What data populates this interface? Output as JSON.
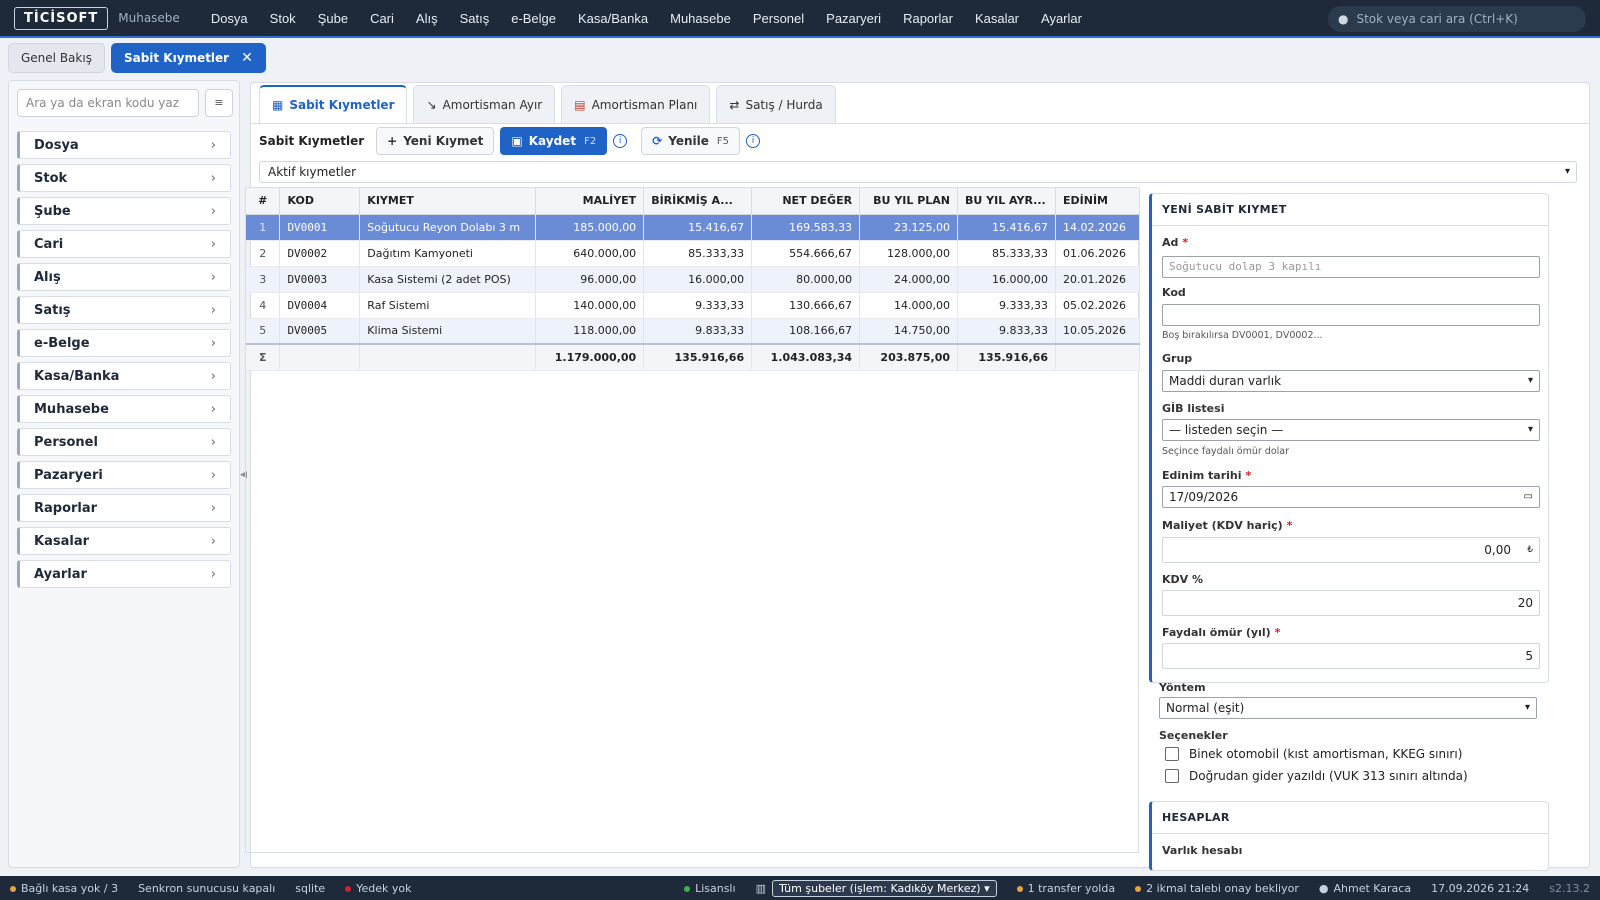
{
  "app": {
    "logo": "TİCİSOFT",
    "module": "Muhasebe"
  },
  "menu": [
    "Dosya",
    "Stok",
    "Şube",
    "Cari",
    "Alış",
    "Satış",
    "e-Belge",
    "Kasa/Banka",
    "Muhasebe",
    "Personel",
    "Pazaryeri",
    "Raporlar",
    "Kasalar",
    "Ayarlar"
  ],
  "global_search": {
    "placeholder": "Stok veya cari ara (Ctrl+K)"
  },
  "page_tabs": [
    {
      "label": "Genel Bakış"
    },
    {
      "label": "Sabit Kıymetler"
    }
  ],
  "page_tab_close": "✕",
  "sidebar": {
    "search_placeholder": "Ara ya da ekran kodu yaz",
    "items": [
      "Dosya",
      "Stok",
      "Şube",
      "Cari",
      "Alış",
      "Satış",
      "e-Belge",
      "Kasa/Banka",
      "Muhasebe",
      "Personel",
      "Pazaryeri",
      "Raporlar",
      "Kasalar",
      "Ayarlar"
    ]
  },
  "inner_tabs": [
    {
      "label": "Sabit Kıymetler",
      "icon": "building-icon"
    },
    {
      "label": "Amortisman Ayır",
      "icon": "chart-down-icon"
    },
    {
      "label": "Amortisman Planı",
      "icon": "calendar-icon"
    },
    {
      "label": "Satış / Hurda",
      "icon": "exchange-icon"
    }
  ],
  "toolbar": {
    "title": "Sabit Kıymetler",
    "new_label": "Yeni Kıymet",
    "save_label": "Kaydet",
    "save_key": "F2",
    "refresh_label": "Yenile",
    "refresh_key": "F5"
  },
  "filter": {
    "value": "Aktif kıymetler"
  },
  "table": {
    "headers": [
      "#",
      "KOD",
      "KIYMET",
      "MALİYET",
      "BİRİKMİŞ A...",
      "NET DEĞER",
      "BU YIL PLAN",
      "BU YIL AYR...",
      "EDİNİM"
    ],
    "rows": [
      [
        "1",
        "DV0001",
        "Soğutucu Reyon Dolabı 3 m",
        "185.000,00",
        "15.416,67",
        "169.583,33",
        "23.125,00",
        "15.416,67",
        "14.02.2026"
      ],
      [
        "2",
        "DV0002",
        "Dağıtım Kamyoneti",
        "640.000,00",
        "85.333,33",
        "554.666,67",
        "128.000,00",
        "85.333,33",
        "01.06.2026"
      ],
      [
        "3",
        "DV0003",
        "Kasa Sistemi (2 adet POS)",
        "96.000,00",
        "16.000,00",
        "80.000,00",
        "24.000,00",
        "16.000,00",
        "20.01.2026"
      ],
      [
        "4",
        "DV0004",
        "Raf Sistemi",
        "140.000,00",
        "9.333,33",
        "130.666,67",
        "14.000,00",
        "9.333,33",
        "05.02.2026"
      ],
      [
        "5",
        "DV0005",
        "Klima Sistemi",
        "118.000,00",
        "9.833,33",
        "108.166,67",
        "14.750,00",
        "9.833,33",
        "10.05.2026"
      ]
    ],
    "totals": [
      "Σ",
      "",
      "",
      "1.179.000,00",
      "135.916,66",
      "1.043.083,34",
      "203.875,00",
      "135.916,66",
      ""
    ]
  },
  "form": {
    "title": "YENİ SABİT KIYMET",
    "ad_label": "Ad",
    "ad_placeholder": "Soğutucu dolap 3 kapılı",
    "kod_label": "Kod",
    "kod_value": "",
    "kod_hint": "Boş bırakılırsa DV0001, DV0002...",
    "grup_label": "Grup",
    "grup_value": "Maddi duran varlık",
    "gib_label": "GİB listesi",
    "gib_value": "— listeden seçin —",
    "gib_hint": "Seçince faydalı ömür dolar",
    "edinim_label": "Edinim tarihi",
    "edinim_value": "17/09/2026",
    "maliyet_label": "Maliyet (KDV hariç)",
    "maliyet_value": "0,00",
    "currency": "₺",
    "kdv_label": "KDV %",
    "kdv_value": "20",
    "omur_label": "Faydalı ömür (yıl)",
    "omur_value": "5",
    "yontem_label": "Yöntem",
    "yontem_value": "Normal (eşit)",
    "secenekler_label": "Seçenekler",
    "opt1": "Binek otomobil (kıst amortisman, KKEG sınırı)",
    "opt2": "Doğrudan gider yazıldı (VUK 313 sınırı altında)",
    "required_mark": "*"
  },
  "accounts": {
    "title": "HESAPLAR",
    "first_label": "Varlık hesabı"
  },
  "status": {
    "kasa": "Bağlı kasa yok / 3",
    "sync": "Senkron sunucusu kapalı",
    "db": "sqlite",
    "backup": "Yedek yok",
    "license": "Lisanslı",
    "branch": "Tüm şubeler (işlem: Kadıköy Merkez)",
    "transfer": "1 transfer yolda",
    "ikmal": "2 ikmal talebi onay bekliyor",
    "user": "Ahmet Karaca",
    "datetime": "17.09.2026 21:24",
    "version": "s2.13.2"
  },
  "colors": {
    "accent": "#1f63c6",
    "topbar": "#1e2a3a",
    "selected_row": "#6a8bd6",
    "required": "#d3202b"
  }
}
